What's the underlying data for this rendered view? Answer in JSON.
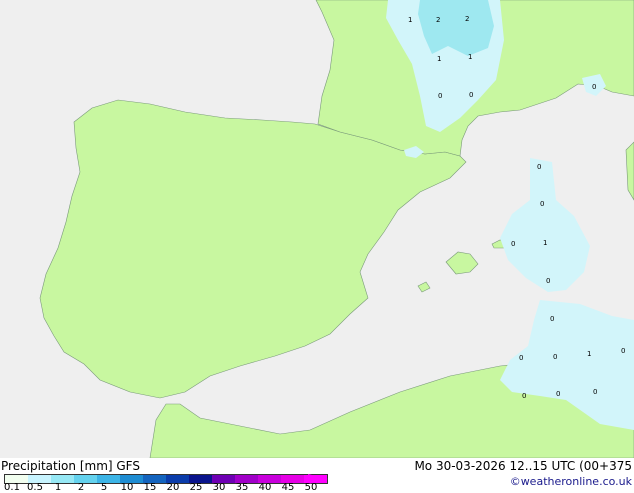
{
  "legend": {
    "title": "Precipitation [mm]  GFS",
    "datetime": "Mo 30-03-2026 12..15 UTC (00+375",
    "credit": "©weatheronline.co.uk",
    "scale_labels": [
      "0.1",
      "0.5",
      "1",
      "2",
      "5",
      "10",
      "15",
      "20",
      "25",
      "30",
      "35",
      "40",
      "45",
      "50"
    ],
    "scale_colors": [
      "#f2fff0",
      "#c8f4ff",
      "#96e8f5",
      "#64d2ee",
      "#3cb4e6",
      "#1e8cd2",
      "#1464be",
      "#0a3caa",
      "#0a148c",
      "#6e00b4",
      "#a000c8",
      "#c800dc",
      "#e600e6",
      "#ff00ff"
    ]
  },
  "map": {
    "colors": {
      "sea": "#efefef",
      "land": "#c8f7a0",
      "light_precip": "#d2f5fa",
      "medium_precip": "#9ee8f0",
      "border": "#7a9a7a"
    },
    "contour_values": [
      "1",
      "2",
      "2",
      "1",
      "1",
      "0",
      "0",
      "0",
      "0",
      "0",
      "1",
      "0",
      "0",
      "0",
      "0",
      "1",
      "0",
      "0",
      "0",
      "0",
      "0"
    ]
  }
}
